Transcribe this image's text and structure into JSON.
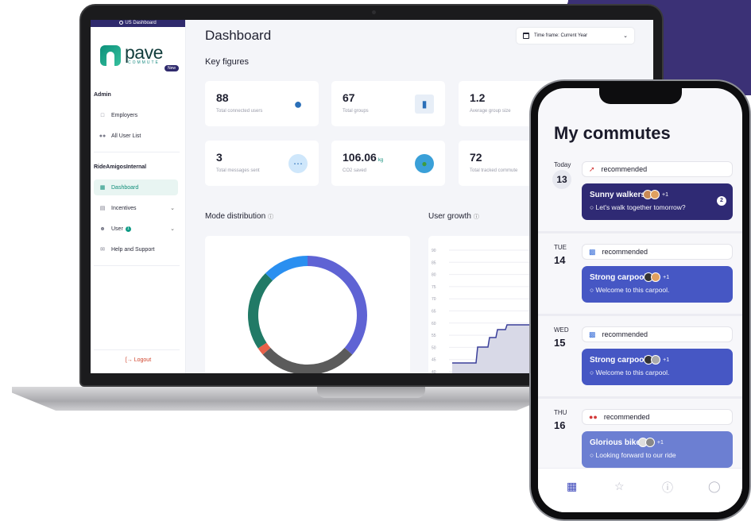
{
  "laptop": {
    "banner": "US Dashboard",
    "logo": {
      "word": "pave",
      "sub": "COMMUTE",
      "badge": "New"
    },
    "sidebar": {
      "sections": [
        {
          "heading": "Admin",
          "items": [
            {
              "label": "Employers",
              "icon": "briefcase-icon"
            },
            {
              "label": "All User List",
              "icon": "users-icon"
            }
          ]
        },
        {
          "heading": "RideAmigosInternal",
          "items": [
            {
              "label": "Dashboard",
              "icon": "dashboard-icon",
              "active": true
            },
            {
              "label": "Incentives",
              "icon": "gift-icon"
            },
            {
              "label": "User",
              "icon": "user-icon",
              "badge": "1"
            },
            {
              "label": "Help and Support",
              "icon": "mail-icon"
            }
          ]
        }
      ],
      "logout": "Logout"
    },
    "main": {
      "title": "Dashboard",
      "timeframe": "Time frame: Current Year",
      "key_figures": "Key figures",
      "cards": [
        {
          "value": "88",
          "label": "Total connected users",
          "icon": "user-icon"
        },
        {
          "value": "67",
          "label": "Total groups",
          "icon": "bar-chart-icon"
        },
        {
          "value": "1.2",
          "label": "Average group size",
          "icon": ""
        },
        {
          "value": "3",
          "label": "Total messages sent",
          "icon": "chat-icon"
        },
        {
          "value": "106.06",
          "unit": "kg",
          "label": "CO2 saved",
          "icon": "globe-icon"
        },
        {
          "value": "72",
          "label": "Total tracked commute",
          "icon": ""
        }
      ],
      "mode_distribution": "Mode distribution",
      "user_growth": "User growth"
    },
    "donut": {
      "values": [
        35,
        26,
        2,
        21,
        12
      ],
      "colors": [
        "#5f63d4",
        "#5b5b5b",
        "#e8614a",
        "#217a66",
        "#2a8ff0"
      ]
    },
    "growth": {
      "yticks": [
        "90",
        "85",
        "80",
        "75",
        "70",
        "65",
        "60",
        "55",
        "50",
        "45",
        "40"
      ]
    }
  },
  "phone": {
    "title": "My commutes",
    "days": [
      {
        "day": "Today",
        "date": "13",
        "today": true,
        "mode": "walk-icon",
        "rec": "recommended",
        "group": "Sunny walkers",
        "plus": "+1",
        "msg": "Let's walk together tomorrow?",
        "count": "2",
        "color": "#2f2a74"
      },
      {
        "day": "TUE",
        "date": "14",
        "mode": "car-icon",
        "rec": "recommended",
        "group": "Strong carpool",
        "plus": "+1",
        "msg": "Welcome to this carpool.",
        "color": "#4657c4"
      },
      {
        "day": "WED",
        "date": "15",
        "mode": "car-icon",
        "rec": "recommended",
        "group": "Strong carpool",
        "plus": "+1",
        "msg": "Welcome to this carpool.",
        "color": "#4657c4"
      },
      {
        "day": "THU",
        "date": "16",
        "mode": "bike-icon",
        "rec": "recommended",
        "group": "Glorious bike",
        "plus": "+1",
        "msg": "Looking forward to our ride",
        "color": "#6c7fd2"
      }
    ],
    "nav": [
      "calendar-icon",
      "star-icon",
      "help-icon",
      "profile-icon"
    ]
  }
}
